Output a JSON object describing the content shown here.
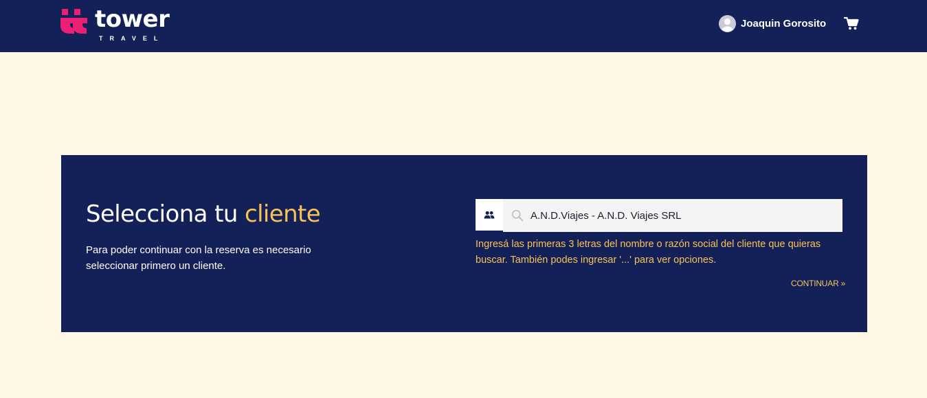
{
  "header": {
    "logo": {
      "word": "tower",
      "sub": "TRAVEL",
      "brand_color": "#ec1f74"
    },
    "user": {
      "name": "Joaquin Gorosito",
      "avatar_icon": "user-avatar-icon"
    },
    "cart_icon": "cart-icon",
    "background": "#142159"
  },
  "panel": {
    "title_main": "Selecciona tu ",
    "title_accent": "cliente",
    "description": "Para poder continuar con la reserva es necesario seleccionar primero un cliente.",
    "search": {
      "prefix_icon": "users-icon",
      "search_icon": "search-icon",
      "value": "A.N.D.Viajes - A.N.D. Viajes SRL"
    },
    "hint": "Ingresá las primeras 3 letras del nombre o razón social del cliente que quieras buscar. También podes ingresar '...' para ver opciones.",
    "continue_label": "CONTINUAR »",
    "accent_color": "#f7c356"
  }
}
